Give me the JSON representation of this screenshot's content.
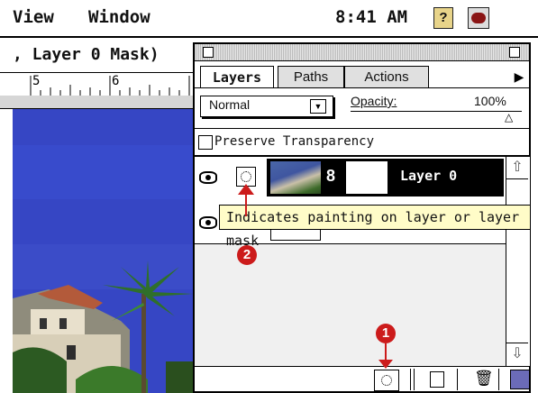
{
  "menubar": {
    "items": [
      "View",
      "Window"
    ],
    "time": "8:41 AM",
    "help_icon": "question-mark-icon",
    "app_icon": "photoshop-eye-icon"
  },
  "document": {
    "title": ", Layer 0 Mask)",
    "ruler_marks": [
      "5",
      "6"
    ]
  },
  "layers_palette": {
    "tabs": [
      "Layers",
      "Paths",
      "Actions"
    ],
    "active_tab": "Layers",
    "blend_mode": "Normal",
    "opacity_label": "Opacity:",
    "opacity_value": "100%",
    "preserve_transparency_label": "Preserve Transparency",
    "preserve_transparency_checked": false,
    "layers": [
      {
        "name": "Layer 0",
        "visible": true,
        "selected": true,
        "has_mask": true
      }
    ]
  },
  "tooltip": {
    "text": "Indicates painting on layer or layer mask"
  },
  "callouts": [
    "2",
    "1"
  ]
}
